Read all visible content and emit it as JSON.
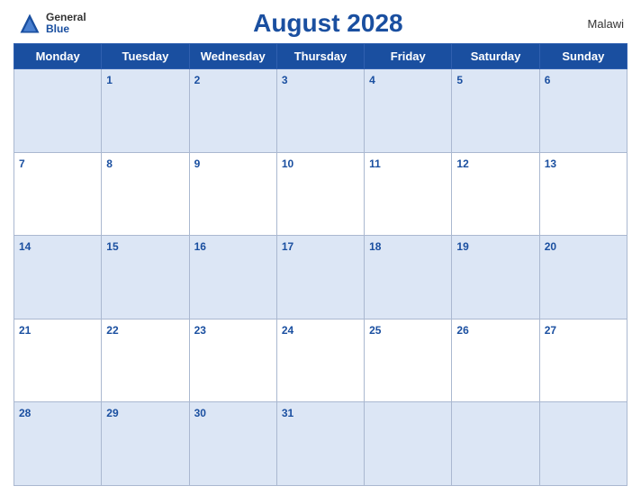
{
  "header": {
    "logo_general": "General",
    "logo_blue": "Blue",
    "title": "August 2028",
    "country": "Malawi"
  },
  "days_of_week": [
    "Monday",
    "Tuesday",
    "Wednesday",
    "Thursday",
    "Friday",
    "Saturday",
    "Sunday"
  ],
  "weeks": [
    [
      {
        "num": "",
        "empty": true
      },
      {
        "num": "1"
      },
      {
        "num": "2"
      },
      {
        "num": "3"
      },
      {
        "num": "4"
      },
      {
        "num": "5"
      },
      {
        "num": "6"
      }
    ],
    [
      {
        "num": "7"
      },
      {
        "num": "8"
      },
      {
        "num": "9"
      },
      {
        "num": "10"
      },
      {
        "num": "11"
      },
      {
        "num": "12"
      },
      {
        "num": "13"
      }
    ],
    [
      {
        "num": "14"
      },
      {
        "num": "15"
      },
      {
        "num": "16"
      },
      {
        "num": "17"
      },
      {
        "num": "18"
      },
      {
        "num": "19"
      },
      {
        "num": "20"
      }
    ],
    [
      {
        "num": "21"
      },
      {
        "num": "22"
      },
      {
        "num": "23"
      },
      {
        "num": "24"
      },
      {
        "num": "25"
      },
      {
        "num": "26"
      },
      {
        "num": "27"
      }
    ],
    [
      {
        "num": "28"
      },
      {
        "num": "29"
      },
      {
        "num": "30"
      },
      {
        "num": "31"
      },
      {
        "num": "",
        "empty": true
      },
      {
        "num": "",
        "empty": true
      },
      {
        "num": "",
        "empty": true
      }
    ]
  ],
  "accent_color": "#1a4fa0"
}
